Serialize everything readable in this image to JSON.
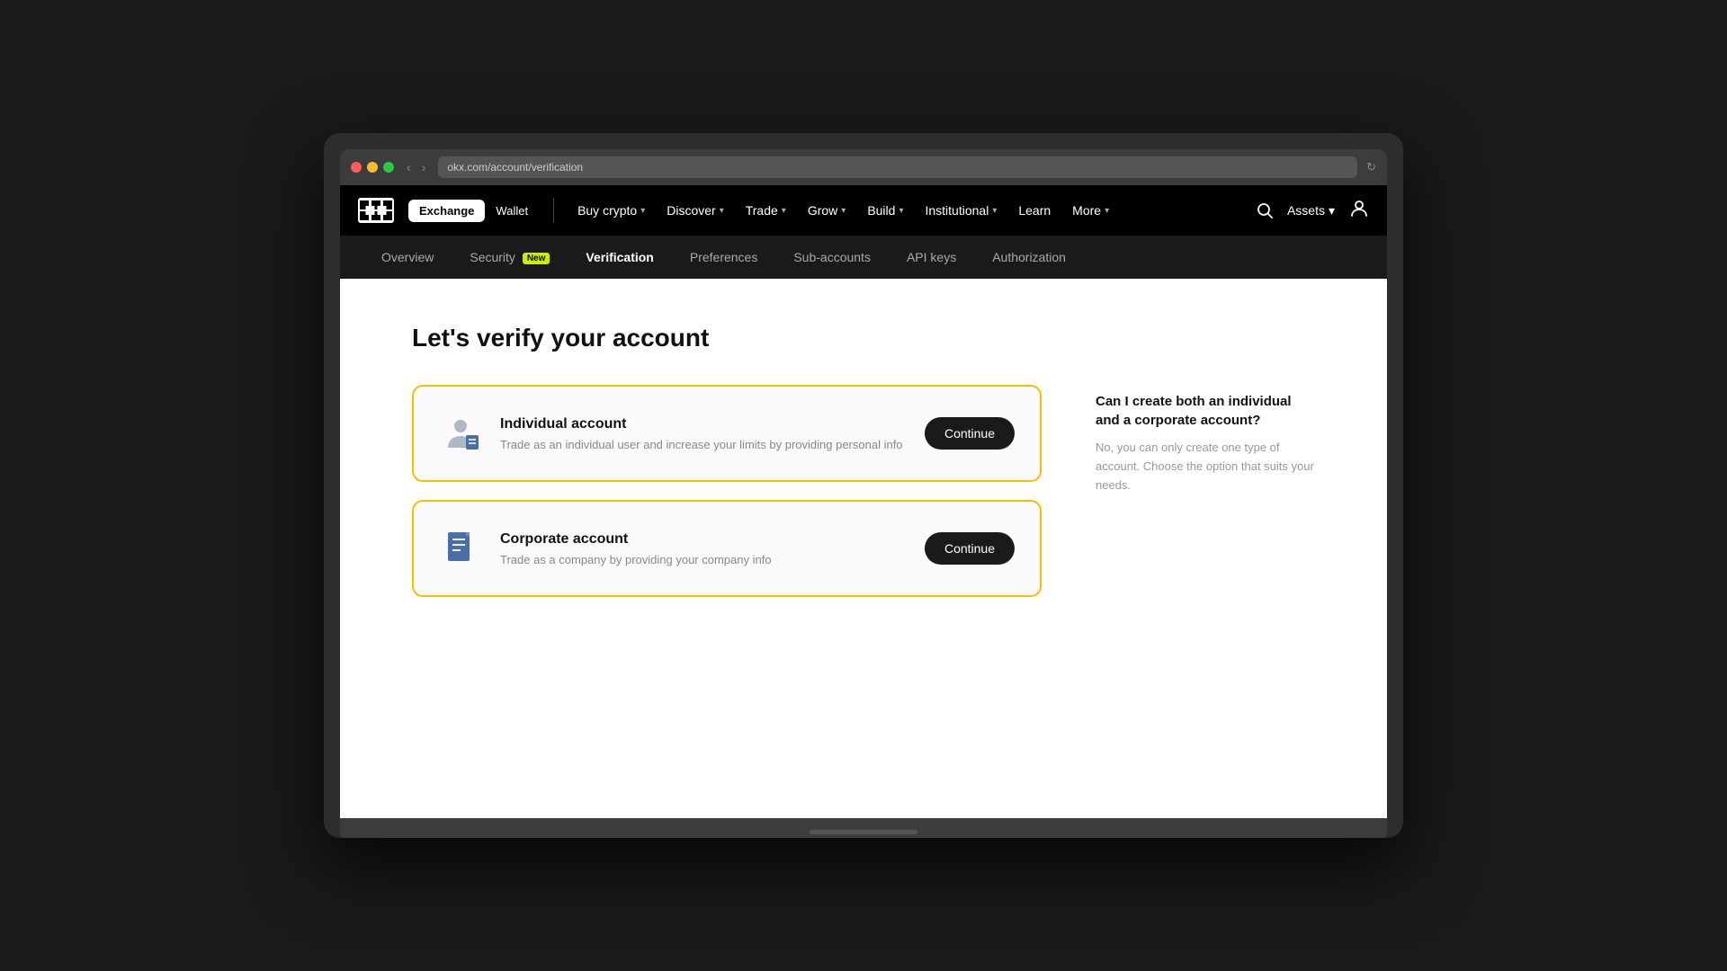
{
  "browser": {
    "url": "okx.com/account/verification"
  },
  "top_nav": {
    "logo_text": "OKX",
    "exchange_label": "Exchange",
    "wallet_label": "Wallet",
    "links": [
      {
        "label": "Buy crypto",
        "has_dropdown": true
      },
      {
        "label": "Discover",
        "has_dropdown": true
      },
      {
        "label": "Trade",
        "has_dropdown": true
      },
      {
        "label": "Grow",
        "has_dropdown": true
      },
      {
        "label": "Build",
        "has_dropdown": true
      },
      {
        "label": "Institutional",
        "has_dropdown": true
      },
      {
        "label": "Learn",
        "has_dropdown": false
      },
      {
        "label": "More",
        "has_dropdown": true
      }
    ],
    "assets_label": "Assets",
    "assets_chevron": "▾"
  },
  "sub_nav": {
    "links": [
      {
        "label": "Overview",
        "active": false
      },
      {
        "label": "Security",
        "active": false,
        "badge": "New"
      },
      {
        "label": "Verification",
        "active": true
      },
      {
        "label": "Preferences",
        "active": false
      },
      {
        "label": "Sub-accounts",
        "active": false
      },
      {
        "label": "API keys",
        "active": false
      },
      {
        "label": "Authorization",
        "active": false
      }
    ]
  },
  "page": {
    "title": "Let's verify your account",
    "cards": [
      {
        "id": "individual",
        "title": "Individual account",
        "description": "Trade as an individual user and increase your limits by providing personal info",
        "button_label": "Continue"
      },
      {
        "id": "corporate",
        "title": "Corporate account",
        "description": "Trade as a company by providing your company info",
        "button_label": "Continue"
      }
    ],
    "faq": {
      "question": "Can I create both an individual and a corporate account?",
      "answer": "No, you can only create one type of account. Choose the option that suits your needs."
    }
  }
}
